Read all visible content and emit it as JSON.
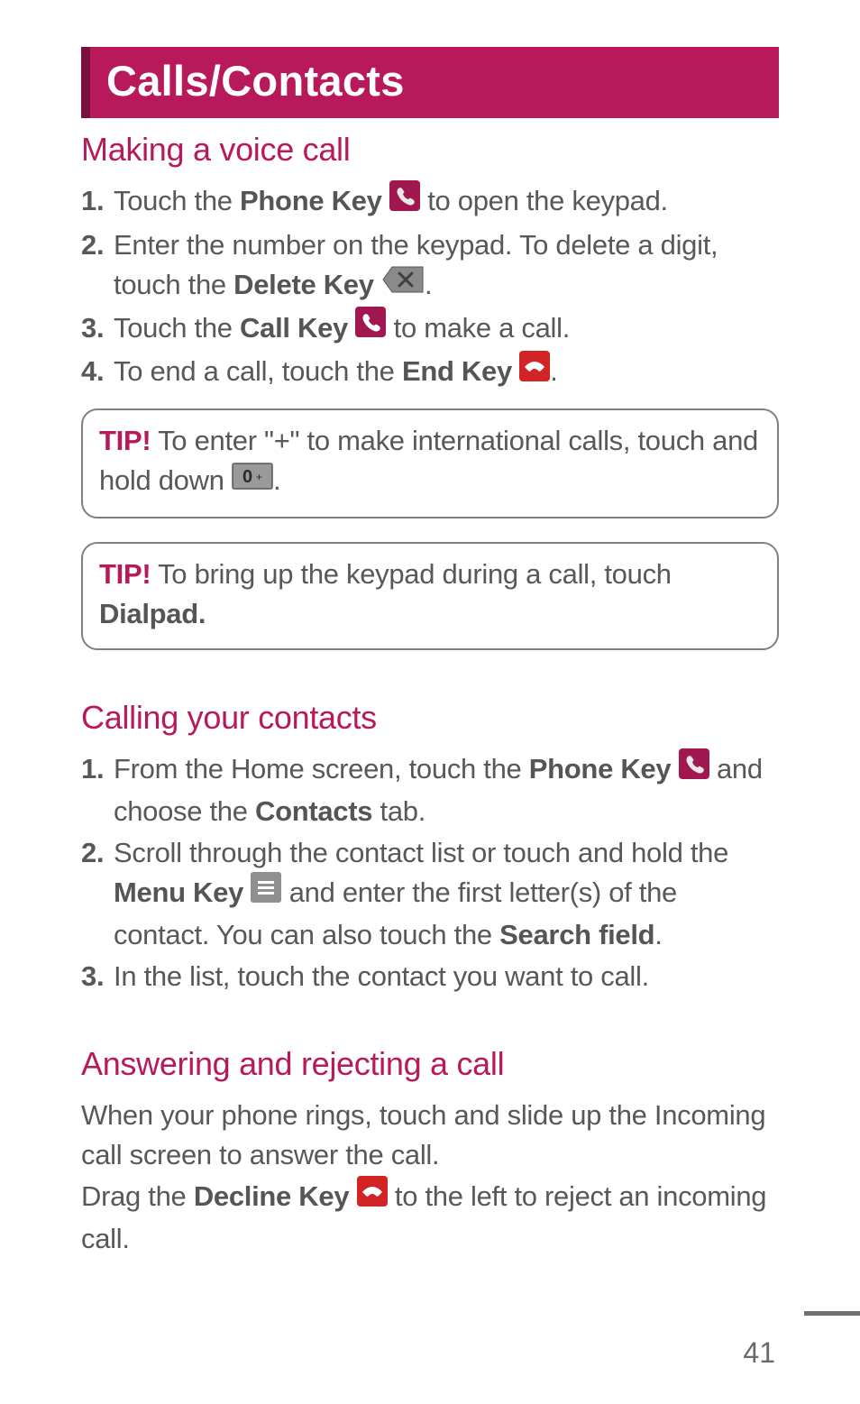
{
  "header": {
    "title": "Calls/Contacts"
  },
  "sections": {
    "voice_call": {
      "heading": "Making a voice call",
      "steps": {
        "s1_num": "1.",
        "s1_a": "Touch the ",
        "s1_b": "Phone Key",
        "s1_c": " to open the keypad.",
        "s2_num": "2.",
        "s2_a": "Enter the number on the keypad. To delete a digit, touch the ",
        "s2_b": "Delete Key",
        "s2_c": ".",
        "s3_num": "3.",
        "s3_a": "Touch the ",
        "s3_b": "Call Key",
        "s3_c": " to make a call.",
        "s4_num": "4.",
        "s4_a": "To end a call, touch the ",
        "s4_b": "End Key",
        "s4_c": "."
      },
      "tip1": {
        "label": "TIP!",
        "text_a": " To enter \"+\" to make international calls, touch and hold down ",
        "text_b": "."
      },
      "tip2": {
        "label": "TIP!",
        "text_a": " To bring up the keypad during a call, touch ",
        "text_b": "Dialpad."
      }
    },
    "calling_contacts": {
      "heading": "Calling your contacts",
      "steps": {
        "s1_num": "1.",
        "s1_a": "From the Home screen, touch the ",
        "s1_b": "Phone Key",
        "s1_c": " and choose the ",
        "s1_d": "Contacts",
        "s1_e": " tab.",
        "s2_num": "2.",
        "s2_a": "Scroll through the contact list or touch and hold the ",
        "s2_b": "Menu Key",
        "s2_c": " and enter the first letter(s) of the contact. You can also touch the ",
        "s2_d": "Search field",
        "s2_e": ".",
        "s3_num": "3.",
        "s3_a": "In the list, touch the contact you want to call."
      }
    },
    "answering": {
      "heading": "Answering and rejecting a call",
      "p1": "When your phone rings, touch and slide up the Incoming call screen to answer the call.",
      "p2_a": "Drag the ",
      "p2_b": "Decline Key",
      "p2_c": " to the left to reject an incoming call."
    }
  },
  "page_number": "41",
  "colors": {
    "brand": "#b7195a",
    "brand_dark": "#7a0f3c",
    "text": "#585858"
  }
}
